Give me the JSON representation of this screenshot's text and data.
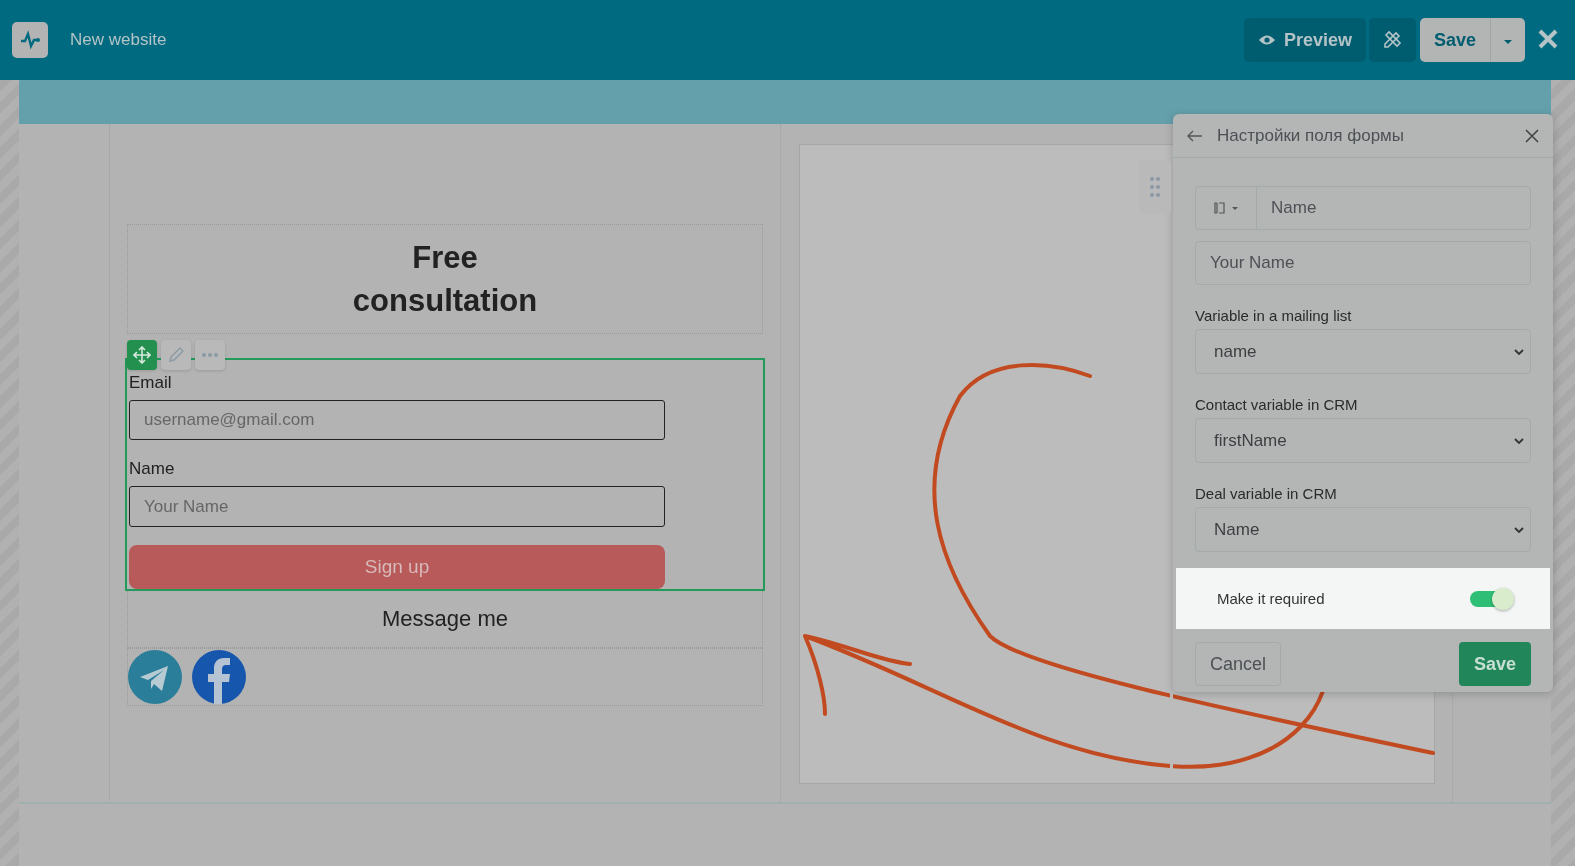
{
  "header": {
    "title": "New website",
    "preview_label": "Preview",
    "save_label": "Save"
  },
  "form_block": {
    "title": "Free consultation",
    "fields": [
      {
        "label": "Email",
        "placeholder": "username@gmail.com"
      },
      {
        "label": "Name",
        "placeholder": "Your Name"
      }
    ],
    "button": "Sign up",
    "messenger_title": "Message me"
  },
  "panel": {
    "title": "Настройки поля формы",
    "field_name": "Name",
    "value": "Your Name",
    "selects": [
      {
        "label": "Variable in a mailing list",
        "value": "name"
      },
      {
        "label": "Contact variable in CRM",
        "value": "firstName"
      },
      {
        "label": "Deal variable in CRM",
        "value": "Name"
      }
    ],
    "required": {
      "label": "Make it required",
      "on": true
    },
    "cancel": "Cancel",
    "save": "Save"
  }
}
